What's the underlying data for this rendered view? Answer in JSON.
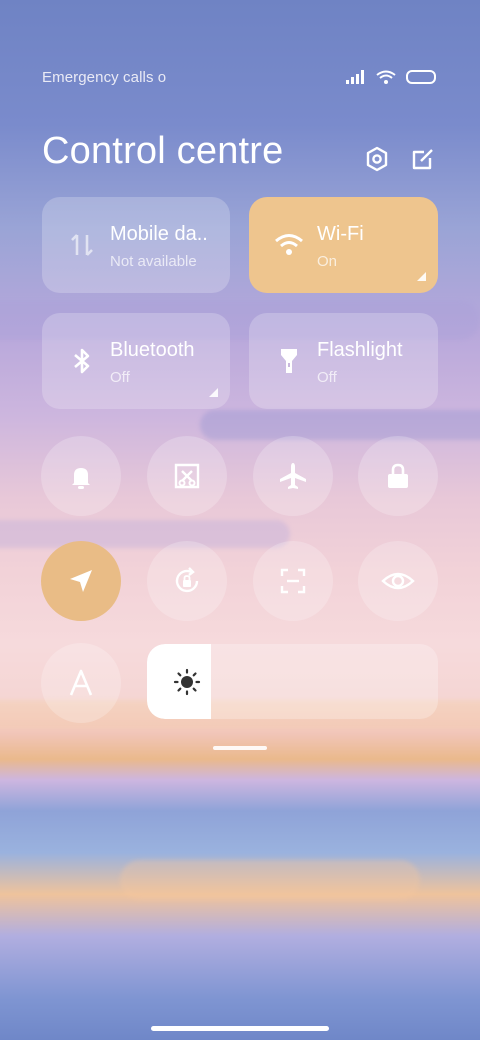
{
  "status": {
    "carrier_text": "Emergency calls o",
    "icons": [
      "signal-icon",
      "wifi-icon",
      "battery-icon"
    ]
  },
  "header": {
    "title": "Control centre",
    "icons": [
      "settings-icon",
      "edit-icon"
    ]
  },
  "tiles": [
    {
      "name": "Mobile da..",
      "sub": "Not available",
      "icon": "mobile-data-icon",
      "active": false
    },
    {
      "name": "Wi-Fi",
      "sub": "On",
      "icon": "wifi-icon",
      "active": true
    },
    {
      "name": "Bluetooth",
      "sub": "Off",
      "icon": "bluetooth-icon",
      "active": false
    },
    {
      "name": "Flashlight",
      "sub": "Off",
      "icon": "flashlight-icon",
      "active": false
    }
  ],
  "toggles_row1": [
    "bell-icon",
    "screenshot-icon",
    "airplane-icon",
    "lock-icon"
  ],
  "toggles_row2": [
    "location-icon",
    "rotation-lock-icon",
    "scan-icon",
    "eye-icon"
  ],
  "toggles_row3": [
    "auto-brightness-icon"
  ],
  "brightness": {
    "level": 0.22,
    "icon": "sun-icon"
  },
  "colors": {
    "accent_active": "#eec58e",
    "tile_inactive": "rgba(255,255,255,0.22)"
  }
}
